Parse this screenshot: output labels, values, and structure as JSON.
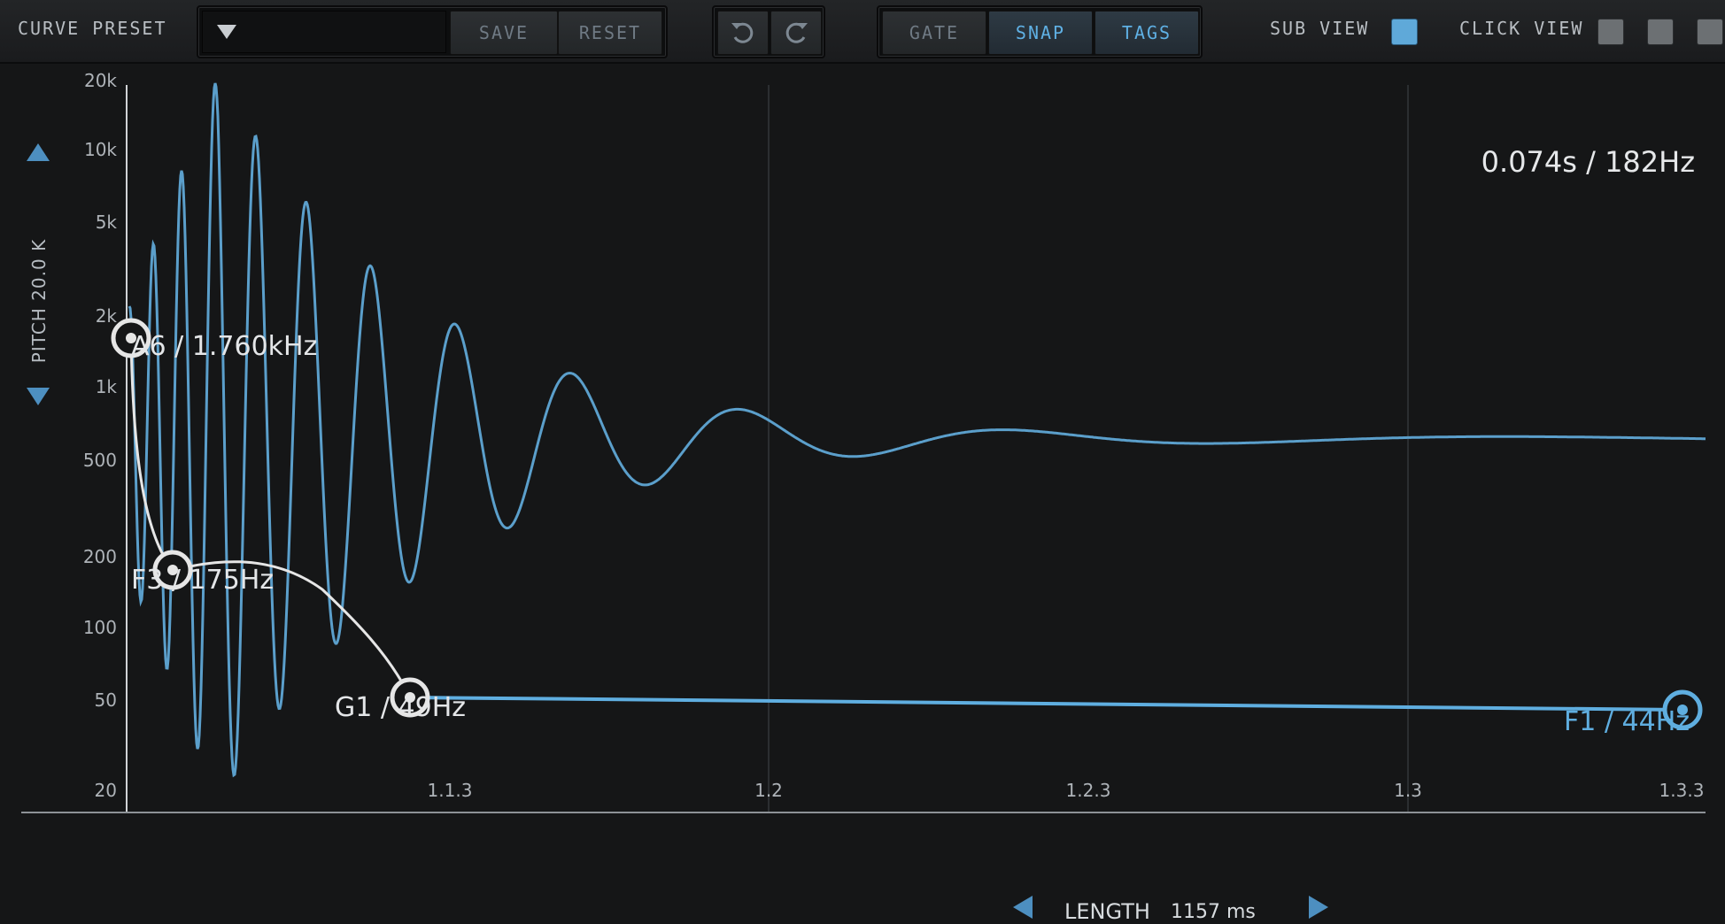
{
  "toolbar": {
    "curve_preset_label": "CURVE PRESET",
    "preset_value": "",
    "save_label": "SAVE",
    "reset_label": "RESET",
    "gate_label": "GATE",
    "snap_label": "SNAP",
    "tags_label": "TAGS",
    "sub_view_label": "SUB VIEW",
    "sub_view_on": true,
    "click_view_label": "CLICK VIEW",
    "click_view_states": [
      false,
      false,
      false
    ]
  },
  "plot": {
    "readout": "0.074s / 182Hz",
    "pitch_label": "PITCH 20.0 K",
    "y_ticks": [
      "20k",
      "10k",
      "5k",
      "2k",
      "1k",
      "500",
      "200",
      "100",
      "50",
      "20"
    ],
    "x_ticks": [
      "1.1.3",
      "1.2",
      "1.2.3",
      "1.3",
      "1.3.3"
    ],
    "nodes": [
      {
        "label": "A6 / 1.760kHz"
      },
      {
        "label": "F3 / 175Hz"
      },
      {
        "label": "G1 / 49Hz"
      },
      {
        "label": "F1 / 44Hz"
      }
    ],
    "length_label": "LENGTH",
    "length_value": "1157 ms"
  },
  "colors": {
    "accent": "#5faee0",
    "waveform": "#5b9fcb",
    "curve": "#e6e6e6",
    "background": "#151617"
  }
}
